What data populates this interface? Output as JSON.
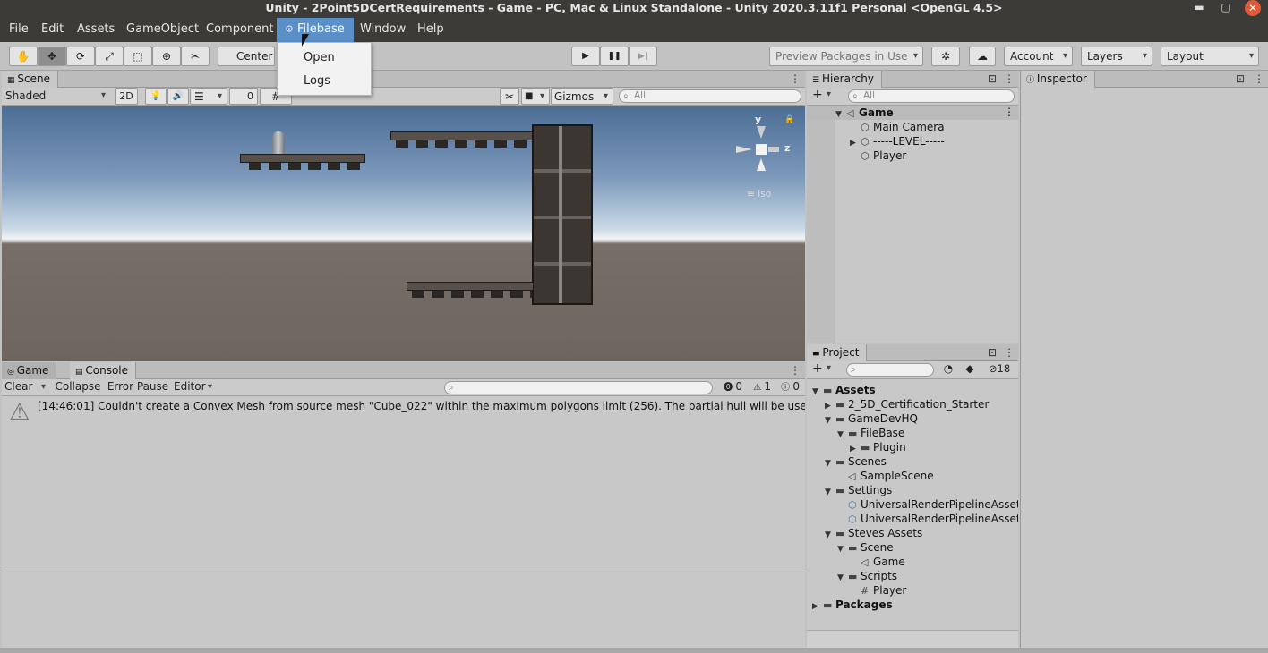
{
  "window": {
    "title": "Unity - 2Point5DCertRequirements - Game - PC, Mac & Linux Standalone - Unity 2020.3.11f1 Personal <OpenGL 4.5>",
    "minimize_glyph": "▬",
    "maximize_glyph": "▢",
    "close_glyph": "✕"
  },
  "menubar": {
    "items": [
      "File",
      "Edit",
      "Assets",
      "GameObject",
      "Component",
      "Filebase",
      "Window",
      "Help"
    ],
    "active": "Filebase",
    "filebase_icon": "⚙"
  },
  "filebase_dropdown": {
    "items": [
      "Open",
      "Logs"
    ]
  },
  "toolbar": {
    "tool_icons": {
      "hand": "✋",
      "move": "✥",
      "rotate": "⟳",
      "scale": "⤢",
      "rect": "⬚",
      "transform": "⊕",
      "custom": "✂"
    },
    "pivot_label": "Center",
    "play_glyph": "▶",
    "pause_glyph": "❚❚",
    "step_glyph": "▶|",
    "preview_packages_label": "Preview Packages in Use",
    "settings_glyph": "✲",
    "cloud_glyph": "☁",
    "account_label": "Account",
    "layers_label": "Layers",
    "layout_label": "Layout"
  },
  "scene_panel": {
    "tab_label": "Scene",
    "shading_mode": "Shaded",
    "mode_2d_label": "2D",
    "light_glyph": "💡",
    "audio_glyph": "🔊",
    "fx_glyph": "☰",
    "hidden_count": "0",
    "gizmos_label": "Gizmos",
    "search_placeholder": "All",
    "axis_y": "y",
    "axis_z": "z",
    "iso_label": "≡ Iso"
  },
  "bottom_panel": {
    "tabs": [
      "Game",
      "Console"
    ],
    "active_tab": "Console",
    "buttons": {
      "clear": "Clear",
      "collapse": "Collapse",
      "error_pause": "Error Pause",
      "editor": "Editor"
    },
    "counts": {
      "errors": "0",
      "warnings": "1",
      "info": "0"
    },
    "messages": [
      "[14:46:01] Couldn't create a Convex Mesh from source mesh \"Cube_022\" within the maximum polygons limit (256). The partial hull will be used. Consider s"
    ]
  },
  "hierarchy": {
    "tab_label": "Hierarchy",
    "add_glyph": "+",
    "search_placeholder": "All",
    "scene_name": "Game",
    "items": [
      "Main Camera",
      "-----LEVEL-----",
      "Player"
    ]
  },
  "inspector": {
    "tab_label": "Inspector"
  },
  "project": {
    "tab_label": "Project",
    "add_glyph": "+",
    "hidden_packages_count": "18",
    "tree": [
      {
        "label": "Assets",
        "depth": 0,
        "expanded": true,
        "type": "folder",
        "bold": true
      },
      {
        "label": "2_5D_Certification_Starter",
        "depth": 1,
        "expanded": false,
        "type": "folder"
      },
      {
        "label": "GameDevHQ",
        "depth": 1,
        "expanded": true,
        "type": "folder"
      },
      {
        "label": "FileBase",
        "depth": 2,
        "expanded": true,
        "type": "folder"
      },
      {
        "label": "Plugin",
        "depth": 3,
        "expanded": false,
        "type": "folder"
      },
      {
        "label": "Scenes",
        "depth": 1,
        "expanded": true,
        "type": "folder"
      },
      {
        "label": "SampleScene",
        "depth": 2,
        "type": "scene"
      },
      {
        "label": "Settings",
        "depth": 1,
        "expanded": true,
        "type": "folder"
      },
      {
        "label": "UniversalRenderPipelineAsset",
        "depth": 2,
        "type": "asset"
      },
      {
        "label": "UniversalRenderPipelineAsset_",
        "depth": 2,
        "type": "asset"
      },
      {
        "label": "Steves Assets",
        "depth": 1,
        "expanded": true,
        "type": "folder"
      },
      {
        "label": "Scene",
        "depth": 2,
        "expanded": true,
        "type": "folder"
      },
      {
        "label": "Game",
        "depth": 3,
        "type": "scene"
      },
      {
        "label": "Scripts",
        "depth": 2,
        "expanded": true,
        "type": "folder"
      },
      {
        "label": "Player",
        "depth": 3,
        "type": "script"
      },
      {
        "label": "Packages",
        "depth": 0,
        "expanded": false,
        "type": "folder",
        "bold": true
      }
    ]
  }
}
